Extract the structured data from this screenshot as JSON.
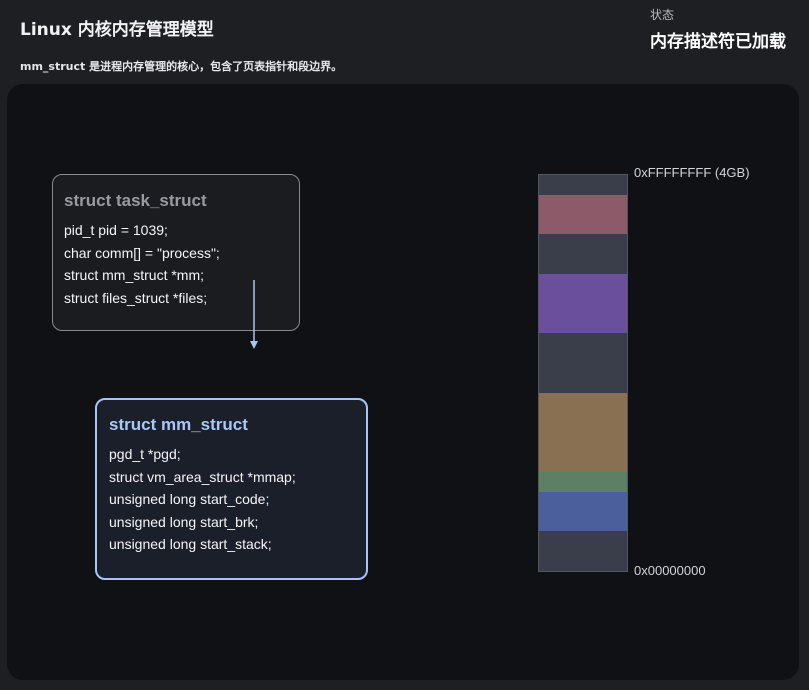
{
  "header": {
    "title": "Linux 内核内存管理模型",
    "subtitle": "mm_struct 是进程内存管理的核心，包含了页表指针和段边界。",
    "status_label": "状态",
    "status_value": "内存描述符已加载"
  },
  "task_struct": {
    "title": "struct task_struct",
    "fields": [
      "pid_t pid = 1039;",
      "char comm[] = \"process\";",
      "struct mm_struct *mm;",
      "struct files_struct *files;"
    ]
  },
  "mm_struct": {
    "title": "struct mm_struct",
    "fields": [
      "pgd_t *pgd;",
      "struct vm_area_struct *mmap;",
      "unsigned long start_code;",
      "unsigned long start_brk;",
      "unsigned long start_stack;"
    ]
  },
  "memory_map": {
    "top_label": "0xFFFFFFFF (4GB)",
    "bottom_label": "0x00000000",
    "base_color": "#3a3d4a",
    "segments": [
      {
        "from_top": 0.05,
        "to_top": 0.15,
        "color": "#8c5a68"
      },
      {
        "from_top": 0.25,
        "to_top": 0.4,
        "color": "#6a4f9c"
      },
      {
        "from_top": 0.55,
        "to_top": 0.75,
        "color": "#8a7053"
      },
      {
        "from_top": 0.75,
        "to_top": 0.8,
        "color": "#5d8064"
      },
      {
        "from_top": 0.8,
        "to_top": 0.9,
        "color": "#4a5f9b"
      }
    ]
  },
  "colors": {
    "accent": "#a7c4f3",
    "arrow": "#a7c4f3",
    "canvas_bg": "#101115",
    "page_bg": "#1e1f22"
  }
}
